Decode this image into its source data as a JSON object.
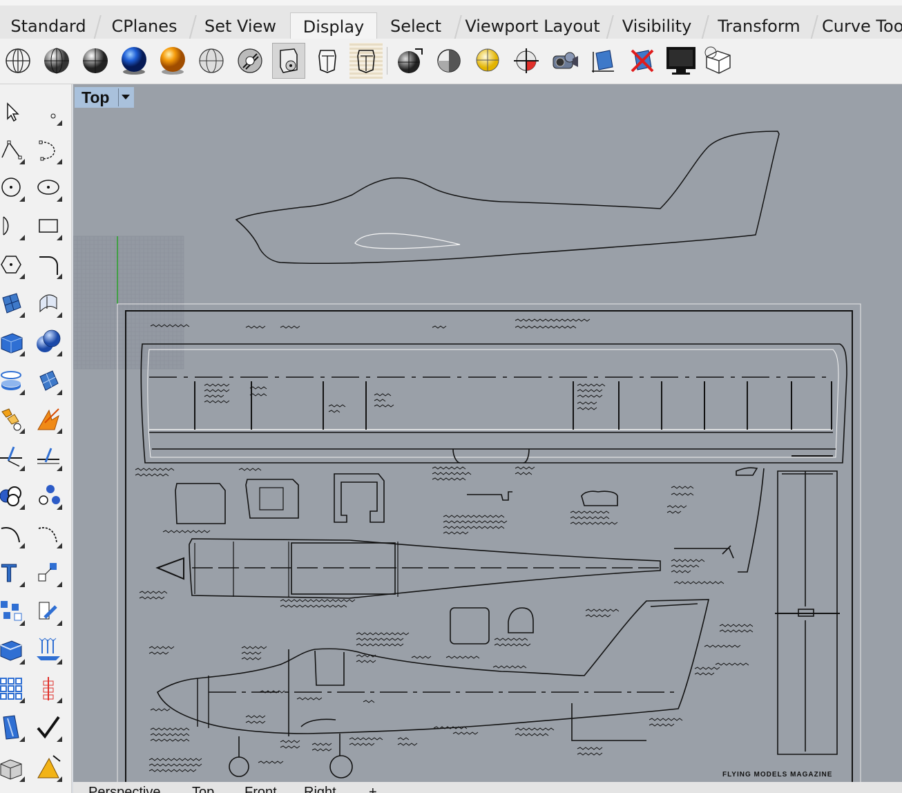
{
  "tabs": [
    {
      "label": "Standard"
    },
    {
      "label": "CPlanes"
    },
    {
      "label": "Set View"
    },
    {
      "label": "Display"
    },
    {
      "label": "Select"
    },
    {
      "label": "Viewport Layout"
    },
    {
      "label": "Visibility"
    },
    {
      "label": "Transform"
    },
    {
      "label": "Curve Too"
    }
  ],
  "active_tab": "Display",
  "toolbar_icons": [
    "wireframe-icon",
    "shaded-icon",
    "rendered-icon",
    "rendered-blue-icon",
    "rendered-gold-icon",
    "ghosted-icon",
    "xray-icon",
    "technical-icon",
    "artistic-icon",
    "pen-icon",
    "shade-all-icon",
    "half-shaded-icon",
    "light-bulb-icon",
    "cplane-axes-icon",
    "camera-icon",
    "box-icon",
    "hide-object-icon",
    "display-monitor-icon",
    "box-edit-icon"
  ],
  "viewport": {
    "title": "Top"
  },
  "drawing": {
    "magazine_label": "FLYING MODELS MAGAZINE"
  },
  "bottom_tabs": [
    {
      "label": "Perspective"
    },
    {
      "label": "Top"
    },
    {
      "label": "Front"
    },
    {
      "label": "Right"
    },
    {
      "label": "+"
    }
  ],
  "left_icons": [
    "select-arrow-icon",
    "point-icon",
    "polyline-icon",
    "curve-icon",
    "circle-icon",
    "ellipse-icon",
    "arc-icon",
    "rectangle-icon",
    "polygon-icon",
    "fillet-icon",
    "surface-icon",
    "extrude-surface-icon",
    "box-solid-icon",
    "sphere-solid-icon",
    "cylinder-icon",
    "mesh-icon",
    "explode-icon",
    "boolean-icon",
    "trim-icon",
    "split-icon",
    "group-icon",
    "ungroup-icon",
    "offset-icon",
    "blend-icon",
    "text-icon",
    "scale-icon",
    "array-icon",
    "move-icon",
    "extrude-icon",
    "project-icon",
    "grid-icon",
    "gumball-icon",
    "duplicate-icon",
    "check-icon",
    "solid-tools-icon",
    "render-icon"
  ]
}
